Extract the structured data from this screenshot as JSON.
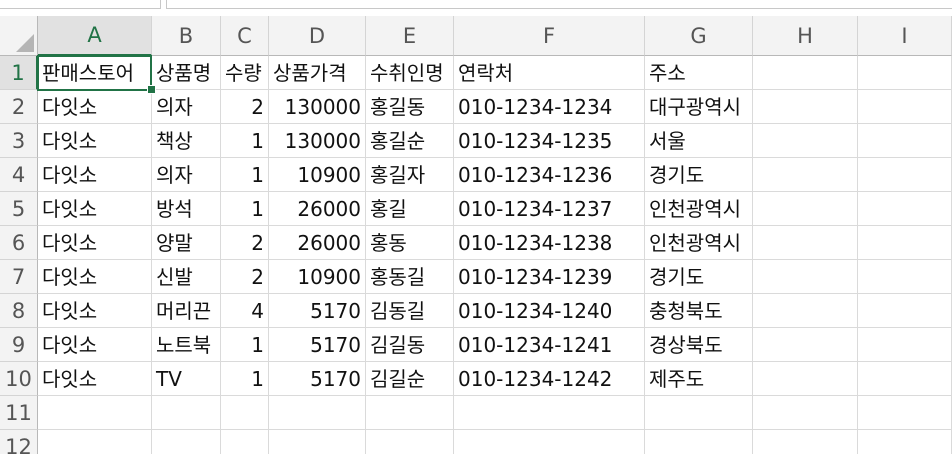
{
  "grid": {
    "columns": [
      "A",
      "B",
      "C",
      "D",
      "E",
      "F",
      "G",
      "H",
      "I"
    ],
    "row_numbers": [
      "1",
      "2",
      "3",
      "4",
      "5",
      "6",
      "7",
      "8",
      "9",
      "10",
      "11",
      "12"
    ],
    "active_column": "A",
    "active_row": "1",
    "headers": [
      "판매스토어",
      "상품명",
      "수량",
      "상품가격",
      "수취인명",
      "연락처",
      "주소"
    ],
    "rows": [
      [
        "다잇소",
        "의자",
        "2",
        "130000",
        "홍길동",
        "010-1234-1234",
        "대구광역시"
      ],
      [
        "다잇소",
        "책상",
        "1",
        "130000",
        "홍길순",
        "010-1234-1235",
        "서울"
      ],
      [
        "다잇소",
        "의자",
        "1",
        "10900",
        "홍길자",
        "010-1234-1236",
        "경기도"
      ],
      [
        "다잇소",
        "방석",
        "1",
        "26000",
        "홍길",
        "010-1234-1237",
        "인천광역시"
      ],
      [
        "다잇소",
        "양말",
        "2",
        "26000",
        "홍동",
        "010-1234-1238",
        "인천광역시"
      ],
      [
        "다잇소",
        "신발",
        "2",
        "10900",
        "홍동길",
        "010-1234-1239",
        "경기도"
      ],
      [
        "다잇소",
        "머리끈",
        "4",
        "5170",
        "김동길",
        "010-1234-1240",
        "충청북도"
      ],
      [
        "다잇소",
        "노트북",
        "1",
        "5170",
        "김길동",
        "010-1234-1241",
        "경상북도"
      ],
      [
        "다잇소",
        "TV",
        "1",
        "5170",
        "김길순",
        "010-1234-1242",
        "제주도"
      ]
    ]
  },
  "colors": {
    "accent": "#217346",
    "header_bg": "#f3f3f3",
    "gridline": "#dadada"
  }
}
